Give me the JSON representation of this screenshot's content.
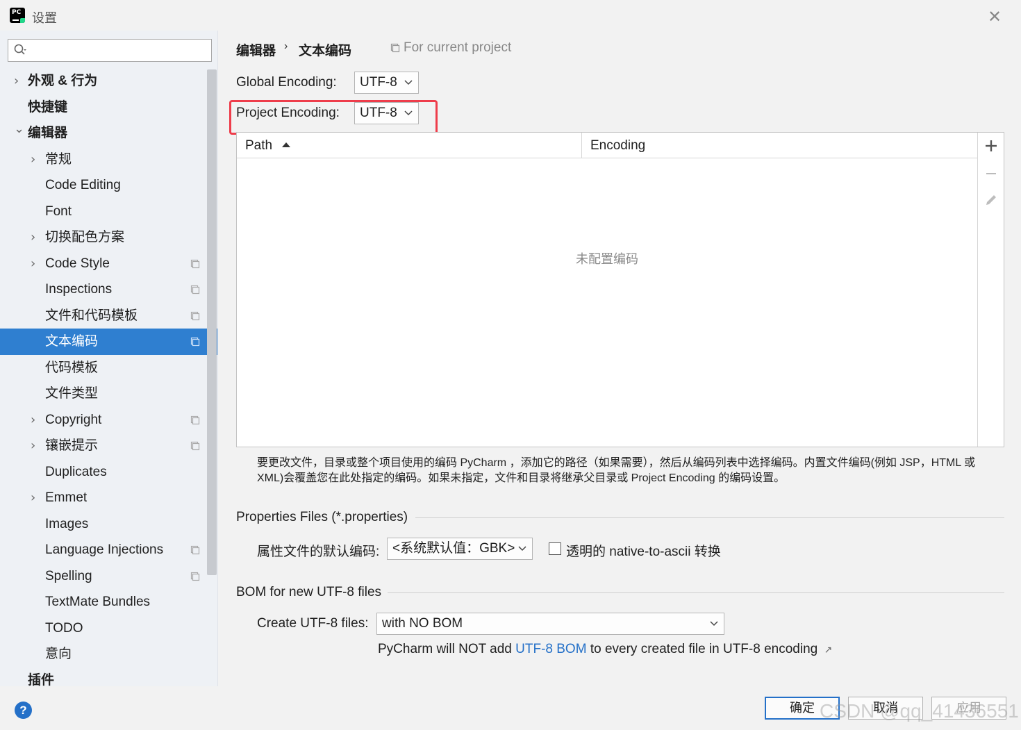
{
  "window": {
    "app_icon_text": "PC",
    "title": "设置"
  },
  "sidebar": {
    "items": [
      {
        "label": "外观 & 行为",
        "level": 0,
        "chevron": "right",
        "scope": false
      },
      {
        "label": "快捷键",
        "level": 0,
        "chevron": "none",
        "scope": false
      },
      {
        "label": "编辑器",
        "level": 0,
        "chevron": "down",
        "scope": false
      },
      {
        "label": "常规",
        "level": 1,
        "chevron": "right",
        "scope": false
      },
      {
        "label": "Code Editing",
        "level": 1,
        "chevron": "none",
        "scope": false
      },
      {
        "label": "Font",
        "level": 1,
        "chevron": "none",
        "scope": false
      },
      {
        "label": "切换配色方案",
        "level": 1,
        "chevron": "right",
        "scope": false
      },
      {
        "label": "Code Style",
        "level": 1,
        "chevron": "right",
        "scope": true
      },
      {
        "label": "Inspections",
        "level": 1,
        "chevron": "none",
        "scope": true
      },
      {
        "label": "文件和代码模板",
        "level": 1,
        "chevron": "none",
        "scope": true
      },
      {
        "label": "文本编码",
        "level": 1,
        "chevron": "none",
        "scope": true,
        "selected": true
      },
      {
        "label": "代码模板",
        "level": 1,
        "chevron": "none",
        "scope": false
      },
      {
        "label": "文件类型",
        "level": 1,
        "chevron": "none",
        "scope": false
      },
      {
        "label": "Copyright",
        "level": 1,
        "chevron": "right",
        "scope": true
      },
      {
        "label": "镶嵌提示",
        "level": 1,
        "chevron": "right",
        "scope": true
      },
      {
        "label": "Duplicates",
        "level": 1,
        "chevron": "none",
        "scope": false
      },
      {
        "label": "Emmet",
        "level": 1,
        "chevron": "right",
        "scope": false
      },
      {
        "label": "Images",
        "level": 1,
        "chevron": "none",
        "scope": false
      },
      {
        "label": "Language Injections",
        "level": 1,
        "chevron": "none",
        "scope": true
      },
      {
        "label": "Spelling",
        "level": 1,
        "chevron": "none",
        "scope": true
      },
      {
        "label": "TextMate Bundles",
        "level": 1,
        "chevron": "none",
        "scope": false
      },
      {
        "label": "TODO",
        "level": 1,
        "chevron": "none",
        "scope": false
      },
      {
        "label": "意向",
        "level": 1,
        "chevron": "none",
        "scope": false
      },
      {
        "label": "插件",
        "level": 0,
        "chevron": "none",
        "scope": false
      }
    ]
  },
  "breadcrumb": {
    "parent": "编辑器",
    "separator": "›",
    "current": "文本编码",
    "scope_note": "For current project"
  },
  "encoding": {
    "global_label": "Global Encoding:",
    "global_value": "UTF-8",
    "project_label": "Project Encoding:",
    "project_value": "UTF-8"
  },
  "table": {
    "col_path": "Path",
    "col_encoding": "Encoding",
    "empty_text": "未配置编码"
  },
  "hint": "要更改文件，目录或整个项目使用的编码 PyCharm ，添加它的路径（如果需要），然后从编码列表中选择编码。内置文件编码(例如 JSP，HTML 或 XML)会覆盖您在此处指定的编码。如果未指定，文件和目录将继承父目录或 Project Encoding 的编码设置。",
  "properties": {
    "section_title": "Properties Files (*.properties)",
    "default_label": "属性文件的默认编码:",
    "default_value": "<系统默认值：GBK>",
    "transparent_label": "透明的 native-to-ascii 转换",
    "transparent_checked": false
  },
  "bom": {
    "section_title": "BOM for new UTF-8 files",
    "create_label": "Create UTF-8 files:",
    "create_value": "with NO BOM",
    "note_prefix": "PyCharm will NOT add ",
    "note_link": "UTF-8 BOM",
    "note_suffix": " to every created file in UTF-8 encoding",
    "note_arrow": "↗"
  },
  "footer": {
    "help": "?",
    "ok": "确定",
    "cancel": "取消",
    "apply": "应用",
    "watermark": "CSDN @qq_41436551"
  },
  "colors": {
    "accent": "#2f7fd0",
    "highlight_box": "#ee3d4b",
    "link": "#2470c8"
  }
}
